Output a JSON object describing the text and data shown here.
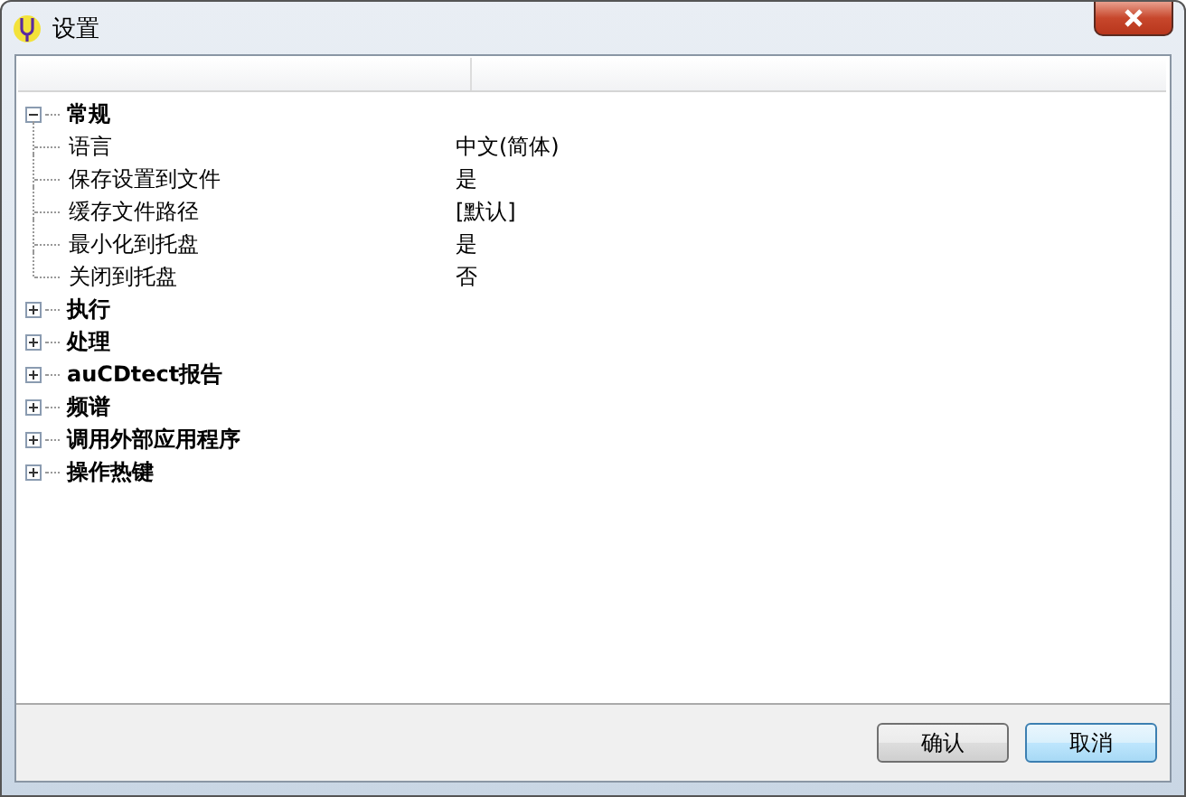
{
  "window": {
    "title": "设置"
  },
  "tree": [
    {
      "label": "常规",
      "expanded": true,
      "children": [
        {
          "name": "语言",
          "value": "中文(简体)"
        },
        {
          "name": "保存设置到文件",
          "value": "是"
        },
        {
          "name": "缓存文件路径",
          "value": "[默认]"
        },
        {
          "name": "最小化到托盘",
          "value": "是"
        },
        {
          "name": "关闭到托盘",
          "value": "否"
        }
      ]
    },
    {
      "label": "执行",
      "expanded": false
    },
    {
      "label": "处理",
      "expanded": false
    },
    {
      "label": "auCDtect报告",
      "expanded": false
    },
    {
      "label": "频谱",
      "expanded": false
    },
    {
      "label": "调用外部应用程序",
      "expanded": false
    },
    {
      "label": "操作热键",
      "expanded": false
    }
  ],
  "buttons": [
    {
      "label": "确认",
      "selected": false
    },
    {
      "label": "取消",
      "selected": true
    }
  ]
}
